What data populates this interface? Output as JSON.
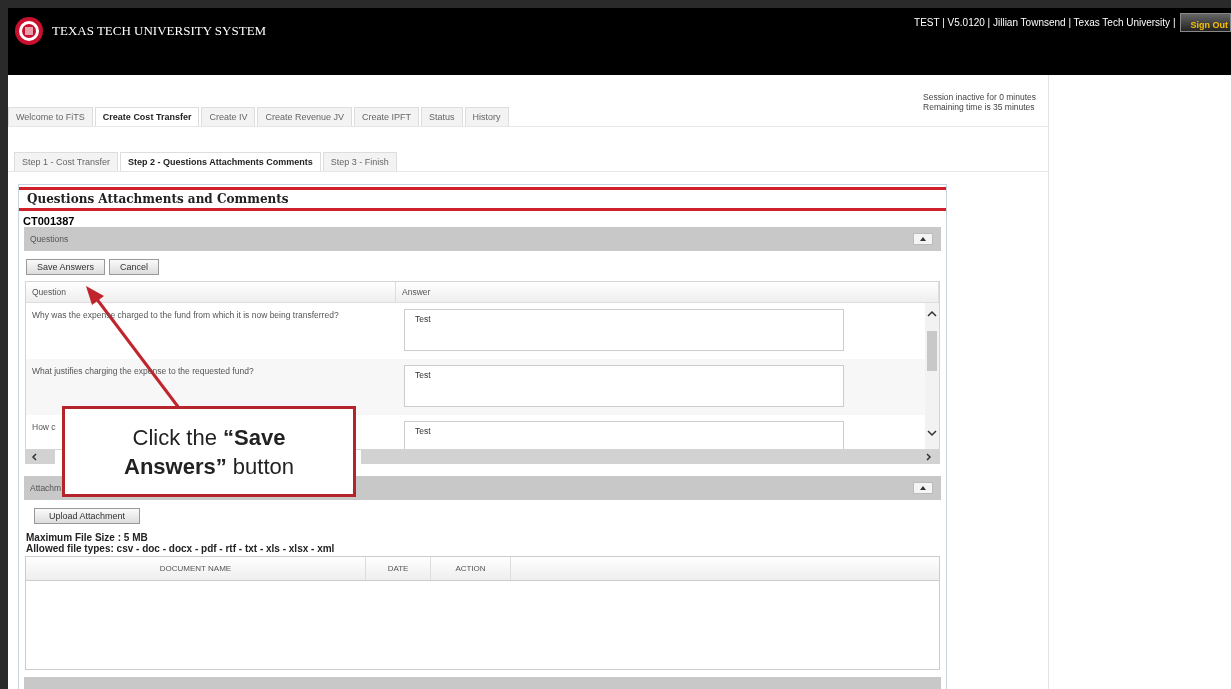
{
  "header": {
    "org_title": "TEXAS TECH UNIVERSITY SYSTEM",
    "user_info": "TEST | V5.0120 | Jillian Townsend | Texas Tech University |",
    "sign_out": "Sign Out"
  },
  "session": [
    "Session inactive for 0 minutes",
    "Remaining time is 35 minutes"
  ],
  "tabs": [
    {
      "label": "Welcome to FiTS",
      "selected": false
    },
    {
      "label": "Create Cost Transfer",
      "selected": true
    },
    {
      "label": "Create IV",
      "selected": false
    },
    {
      "label": "Create Revenue JV",
      "selected": false
    },
    {
      "label": "Create IPFT",
      "selected": false
    },
    {
      "label": "Status",
      "selected": false
    },
    {
      "label": "History",
      "selected": false
    }
  ],
  "steps": [
    {
      "label": "Step 1 - Cost Transfer",
      "selected": false
    },
    {
      "label": "Step 2 - Questions Attachments Comments",
      "selected": true
    },
    {
      "label": "Step 3 - Finish",
      "selected": false
    }
  ],
  "panel": {
    "title": "Questions Attachments and Comments",
    "record_id": "CT001387"
  },
  "questions": {
    "header": "Questions",
    "buttons": [
      "Save Answers",
      "Cancel"
    ],
    "columns": [
      "Question",
      "Answer"
    ],
    "rows": [
      {
        "question": "Why was the expense charged to the fund from which it is now being transferred?",
        "answer": "Test"
      },
      {
        "question": "What justifies charging the expense to the requested fund?",
        "answer": "Test"
      },
      {
        "question": "How c",
        "answer": "Test"
      }
    ]
  },
  "attachments": {
    "header": "Attachm",
    "upload_button": "Upload Attachment",
    "max_size": "Maximum File Size : 5 MB",
    "allowed_types": "Allowed file types: csv - doc - docx - pdf - rtf - txt - xls - xlsx - xml",
    "columns": [
      "DOCUMENT NAME",
      "DATE",
      "ACTION"
    ]
  },
  "callout": {
    "text": "Click the **“Save Answers”** button"
  }
}
